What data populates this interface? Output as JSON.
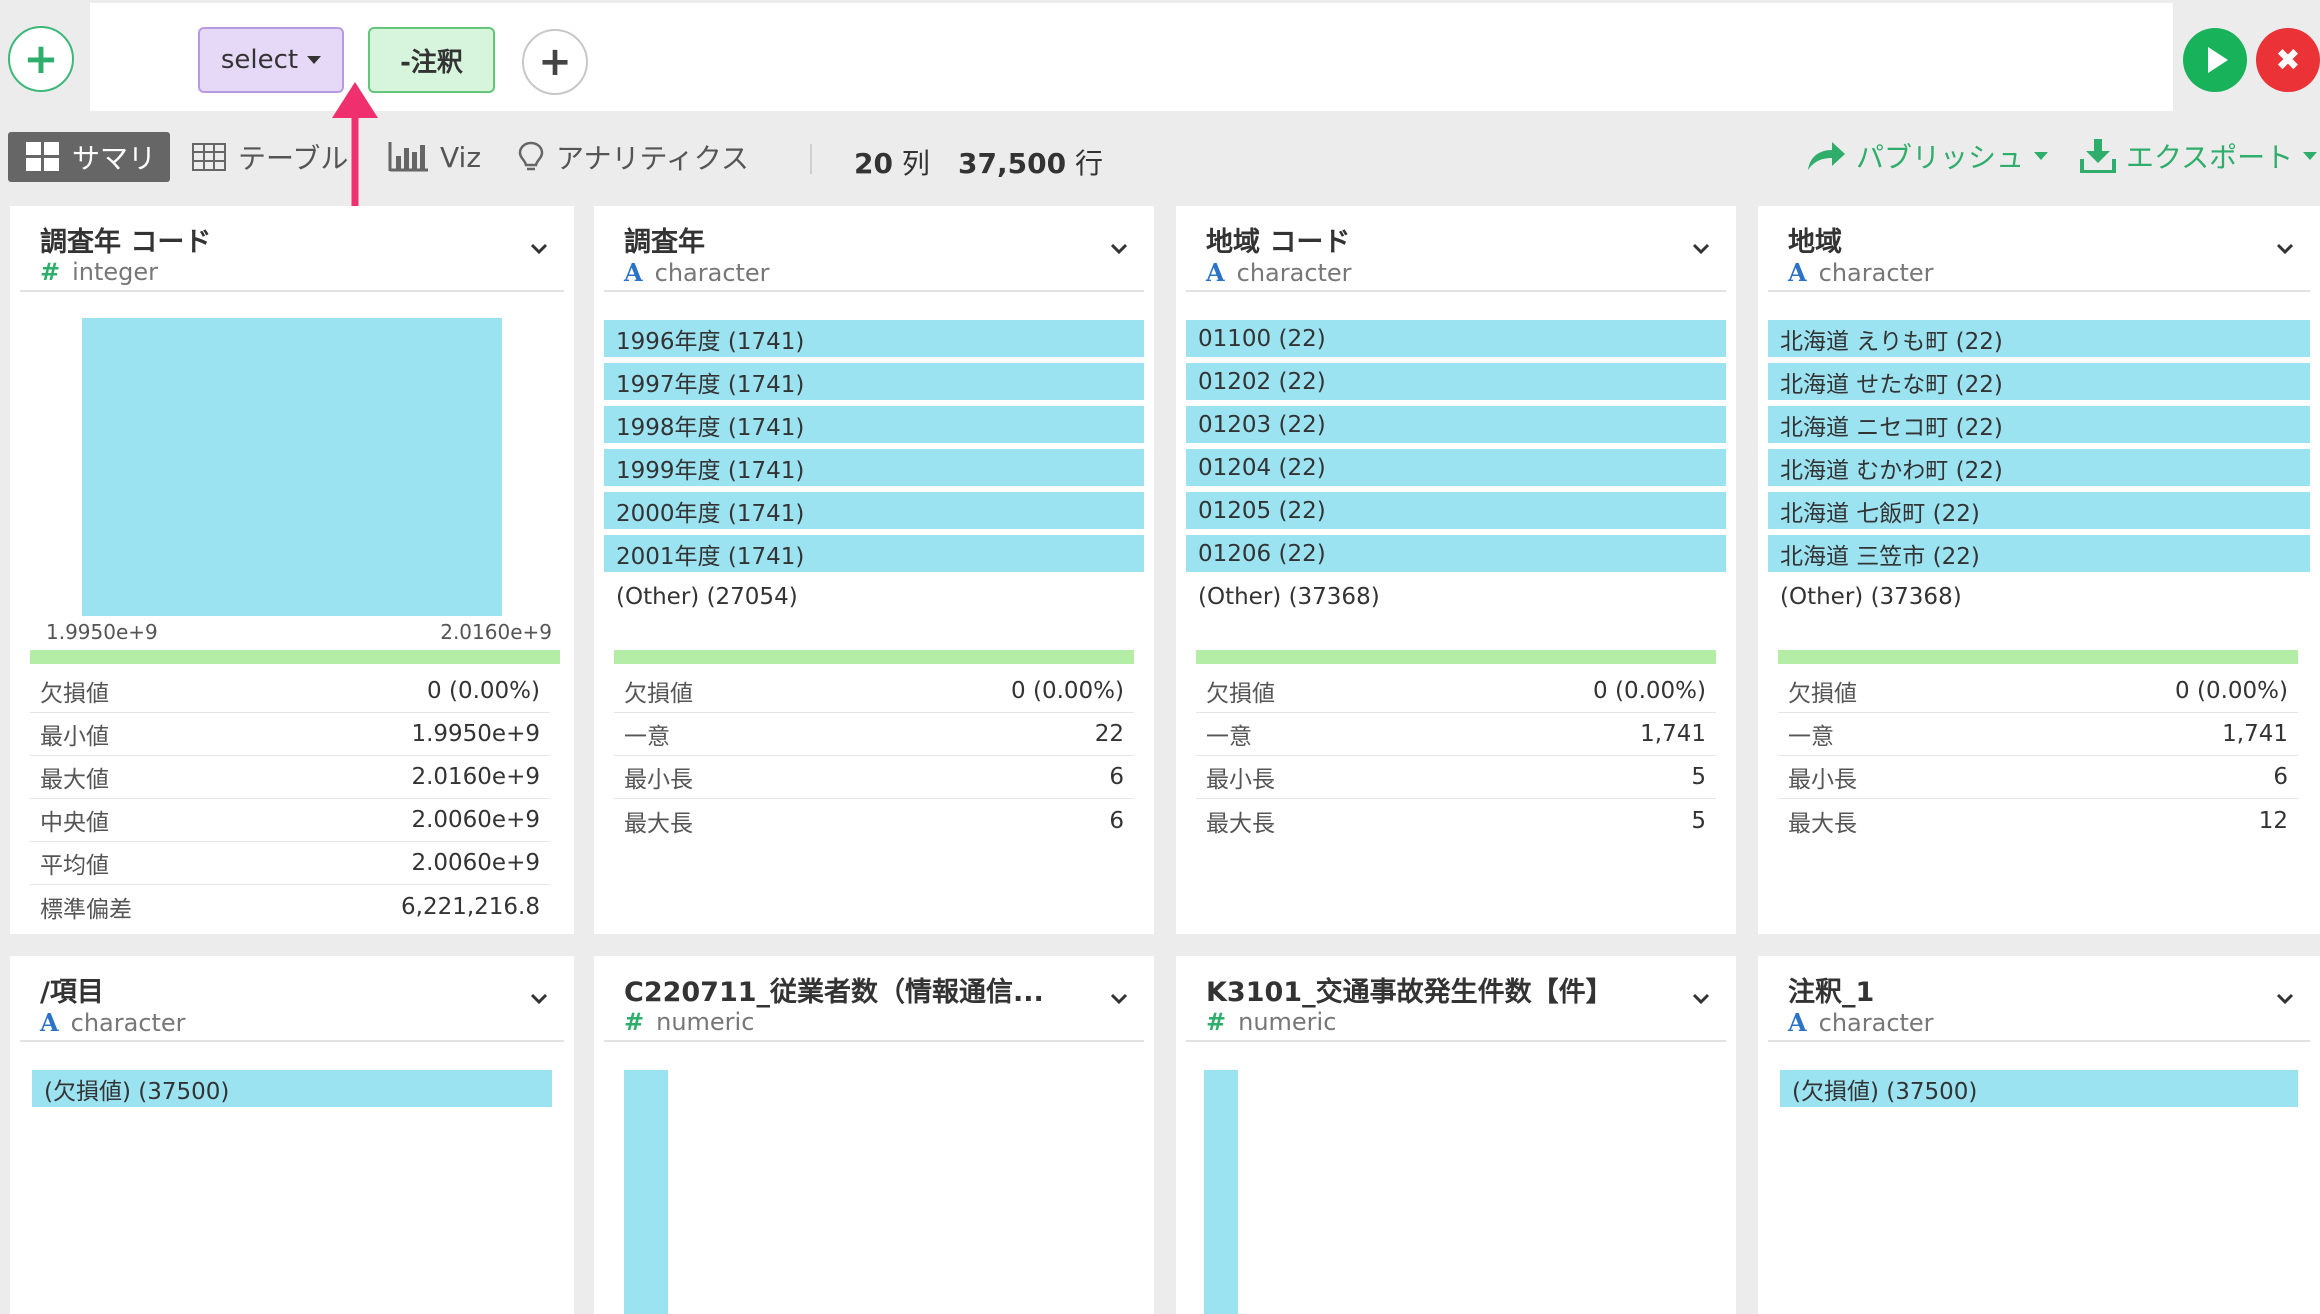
{
  "toolbar": {
    "steps": [
      {
        "label": "select"
      },
      {
        "label": "-注釈"
      }
    ]
  },
  "view_tabs": {
    "summary": "サマリ",
    "table": "テーブル",
    "viz": "Viz",
    "analytics": "アナリティクス"
  },
  "counts": {
    "columns_num": "20",
    "columns_unit": "列",
    "rows_num": "37,500",
    "rows_unit": "行"
  },
  "actions": {
    "publish": "パブリッシュ",
    "export": "エクスポート"
  },
  "cards": [
    {
      "title": "調査年 コード",
      "type": "integer",
      "type_icon": "#",
      "hist_min": "1.9950e+9",
      "hist_max": "2.0160e+9",
      "stats": [
        {
          "label": "欠損値",
          "value": "0 (0.00%)"
        },
        {
          "label": "最小値",
          "value": "1.9950e+9"
        },
        {
          "label": "最大値",
          "value": "2.0160e+9"
        },
        {
          "label": "中央値",
          "value": "2.0060e+9"
        },
        {
          "label": "平均値",
          "value": "2.0060e+9"
        },
        {
          "label": "標準偏差",
          "value": "6,221,216.8"
        }
      ]
    },
    {
      "title": "調査年",
      "type": "character",
      "type_icon": "A",
      "categories": [
        "1996年度 (1741)",
        "1997年度 (1741)",
        "1998年度 (1741)",
        "1999年度 (1741)",
        "2000年度 (1741)",
        "2001年度 (1741)"
      ],
      "other": "(Other) (27054)",
      "stats": [
        {
          "label": "欠損値",
          "value": "0 (0.00%)"
        },
        {
          "label": "一意",
          "value": "22"
        },
        {
          "label": "最小長",
          "value": "6"
        },
        {
          "label": "最大長",
          "value": "6"
        }
      ]
    },
    {
      "title": "地域 コード",
      "type": "character",
      "type_icon": "A",
      "categories": [
        "01100 (22)",
        "01202 (22)",
        "01203 (22)",
        "01204 (22)",
        "01205 (22)",
        "01206 (22)"
      ],
      "other": "(Other) (37368)",
      "stats": [
        {
          "label": "欠損値",
          "value": "0 (0.00%)"
        },
        {
          "label": "一意",
          "value": "1,741"
        },
        {
          "label": "最小長",
          "value": "5"
        },
        {
          "label": "最大長",
          "value": "5"
        }
      ]
    },
    {
      "title": "地域",
      "type": "character",
      "type_icon": "A",
      "categories": [
        "北海道 えりも町 (22)",
        "北海道 せたな町 (22)",
        "北海道 ニセコ町 (22)",
        "北海道 むかわ町 (22)",
        "北海道 七飯町 (22)",
        "北海道 三笠市 (22)"
      ],
      "other": "(Other) (37368)",
      "stats": [
        {
          "label": "欠損値",
          "value": "0 (0.00%)"
        },
        {
          "label": "一意",
          "value": "1,741"
        },
        {
          "label": "最小長",
          "value": "6"
        },
        {
          "label": "最大長",
          "value": "12"
        }
      ]
    },
    {
      "title": "/項目",
      "type": "character",
      "type_icon": "A",
      "categories": [
        "(欠損値) (37500)"
      ]
    },
    {
      "title": "C220711_従業者数（情報通信...",
      "type": "numeric",
      "type_icon": "#"
    },
    {
      "title": "K3101_交通事故発生件数【件】",
      "type": "numeric",
      "type_icon": "#"
    },
    {
      "title": "注釈_1",
      "type": "character",
      "type_icon": "A",
      "categories": [
        "(欠損値) (37500)"
      ]
    }
  ],
  "colors": {
    "accent_green": "#2eae6a",
    "bar_blue": "#9ce3f2",
    "strip_green": "#b4eea6",
    "run": "#18b25a",
    "stop": "#ea3237",
    "arrow": "#f0306e"
  }
}
